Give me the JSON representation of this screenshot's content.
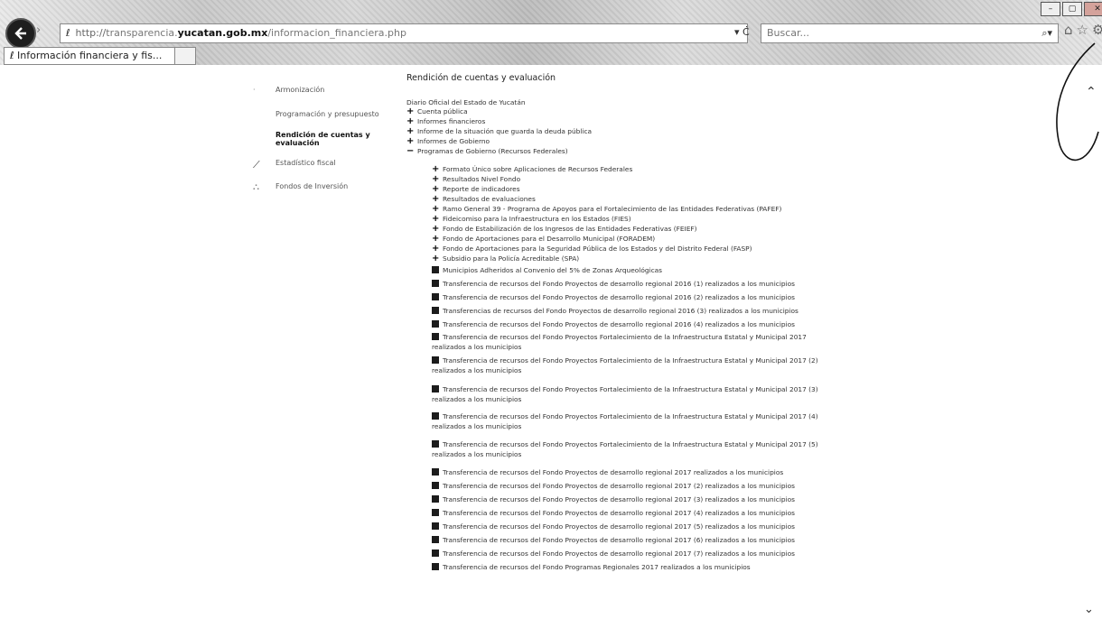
{
  "browser": {
    "address": {
      "protocol": "http",
      "prefix": "transparencia.",
      "host": "yucatan.gob.mx",
      "path": "/informacion_financiera.php"
    },
    "refresh_label": "▾ Ċ",
    "search_placeholder": "Buscar...",
    "tab_title": "Información financiera y fis..."
  },
  "nav": {
    "items": [
      {
        "label": "Armonización"
      },
      {
        "label": "Programación y presupuesto"
      },
      {
        "label": "Rendición de cuentas y evaluación"
      },
      {
        "label": "Estadístico fiscal"
      },
      {
        "label": "Fondos de Inversión"
      }
    ]
  },
  "content": {
    "heading": "Rendición de cuentas y evaluación",
    "org": "Diario Oficial del Estado de Yucatán",
    "sections": [
      "Cuenta pública",
      "Informes financieros",
      "Informe de la situación que guarda la deuda pública",
      "Informes de Gobierno",
      "Programas de Gobierno (Recursos Federales)"
    ],
    "subsections": [
      "Formato Único sobre Aplicaciones de Recursos Federales",
      "Resultados Nivel Fondo",
      "Reporte de indicadores",
      "Resultados de evaluaciones",
      "Ramo General 39 - Programa de Apoyos para el Fortalecimiento de las Entidades Federativas (PAFEF)",
      "Fideicomiso para la Infraestructura en los Estados (FIES)",
      "Fondo de Estabilización de los Ingresos de las Entidades Federativas (FEIEF)",
      "Fondo de Aportaciones para el Desarrollo Municipal (FORADEM)",
      "Fondo de Aportaciones para la Seguridad Pública de los Estados y del Distrito Federal (FASP)",
      "Subsidio para la Policía Acreditable (SPA)"
    ],
    "documents": [
      "Municipios Adheridos al Convenio del 5% de Zonas Arqueológicas",
      "Transferencia de recursos del Fondo Proyectos de desarrollo regional 2016 (1) realizados a los municipios",
      "Transferencia de recursos del Fondo Proyectos de desarrollo regional 2016 (2) realizados a los municipios",
      "Transferencias de recursos del Fondo Proyectos de desarrollo regional 2016 (3) realizados a los municipios",
      "Transferencia de recursos del Fondo Proyectos de desarrollo regional 2016 (4) realizados a los municipios",
      "Transferencia de recursos del Fondo Proyectos Fortalecimiento de la Infraestructura Estatal y Municipal 2017 realizados a los municipios",
      "Transferencia de recursos del Fondo Proyectos Fortalecimiento de la Infraestructura Estatal y Municipal 2017 (2) realizados a los municipios",
      "Transferencia de recursos del Fondo Proyectos Fortalecimiento de la Infraestructura Estatal y Municipal 2017 (3) realizados a los municipios",
      "Transferencia de recursos del Fondo Proyectos Fortalecimiento de la Infraestructura Estatal y Municipal 2017 (4) realizados a los municipios",
      "Transferencia de recursos del Fondo Proyectos Fortalecimiento de la Infraestructura Estatal y Municipal 2017 (5) realizados a los municipios",
      "Transferencia de recursos del Fondo Proyectos de desarrollo regional 2017 realizados a los municipios",
      "Transferencia de recursos del Fondo Proyectos de desarrollo regional 2017 (2) realizados a los municipios",
      "Transferencia de recursos del Fondo Proyectos de desarrollo regional 2017 (3) realizados a los municipios",
      "Transferencia de recursos del Fondo Proyectos de desarrollo regional 2017 (4) realizados a los municipios",
      "Transferencia de recursos del Fondo Proyectos de desarrollo regional 2017 (5) realizados a los municipios",
      "Transferencia de recursos del Fondo Proyectos de desarrollo regional 2017 (6) realizados a los municipios",
      "Transferencia de recursos del Fondo Proyectos de desarrollo regional 2017 (7) realizados a los municipios",
      "Transferencia de recursos del Fondo Programas Regionales 2017 realizados a los municipios"
    ]
  },
  "icons": {
    "back": "back-arrow-icon",
    "search": "magnifier-icon",
    "expand": "plus-icon",
    "collapse": "minus-icon",
    "document": "pdf-icon"
  }
}
